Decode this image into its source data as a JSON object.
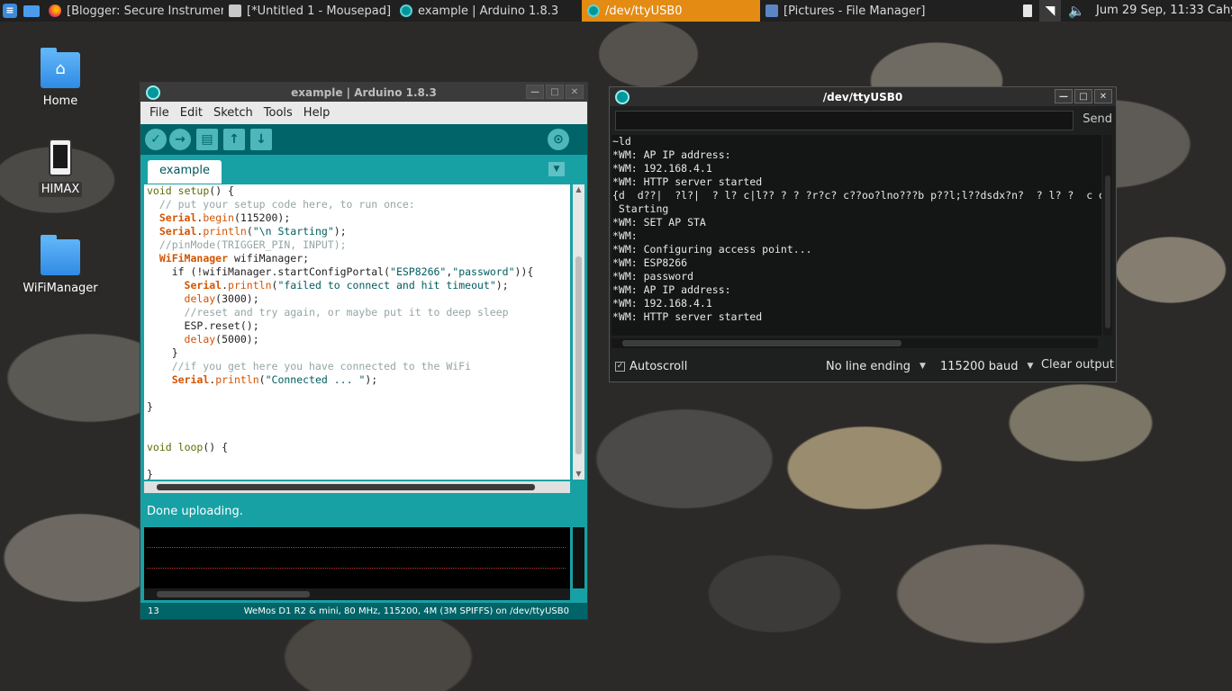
{
  "taskbar": {
    "tasks": [
      {
        "label": "[Blogger: Secure Instrumen..."
      },
      {
        "label": "[*Untitled 1 - Mousepad]"
      },
      {
        "label": "example | Arduino 1.8.3"
      },
      {
        "label": "/dev/ttyUSB0"
      },
      {
        "label": "[Pictures - File Manager]"
      }
    ],
    "clock": "Jum 29 Sep, 11:33",
    "user": "Cahyo"
  },
  "desktop": {
    "icons": [
      {
        "label": "Home",
        "icon": "home-folder-icon"
      },
      {
        "label": "HIMAX",
        "icon": "phone-icon"
      },
      {
        "label": "WiFiManager",
        "icon": "folder-icon"
      }
    ]
  },
  "arduino": {
    "title": "example | Arduino 1.8.3",
    "menu": [
      "File",
      "Edit",
      "Sketch",
      "Tools",
      "Help"
    ],
    "tab": "example",
    "code": [
      "void setup() {",
      "  // put your setup code here, to run once:",
      "  Serial.begin(115200);",
      "  Serial.println(\"\\n Starting\");",
      "  //pinMode(TRIGGER_PIN, INPUT);",
      "  WiFiManager wifiManager;",
      "    if (!wifiManager.startConfigPortal(\"ESP8266\",\"password\")){",
      "      Serial.println(\"failed to connect and hit timeout\");",
      "      delay(3000);",
      "      //reset and try again, or maybe put it to deep sleep",
      "      ESP.reset();",
      "      delay(5000);",
      "    }",
      "    //if you get here you have connected to the WiFi",
      "    Serial.println(\"Connected ... \");",
      "",
      "}",
      "",
      "",
      "void loop() {",
      "",
      "}"
    ],
    "status": "Done uploading.",
    "line_number": "13",
    "board_info": "WeMos D1 R2 & mini, 80 MHz, 115200, 4M (3M SPIFFS) on /dev/ttyUSB0"
  },
  "serial": {
    "title": "/dev/ttyUSB0",
    "input_value": "",
    "send_label": "Send",
    "output": [
      "~ld",
      "*WM: AP IP address:",
      "*WM: 192.168.4.1",
      "*WM: HTTP server started",
      "{d  d??|  ?l?|  ? l? c|l?? ? ? ?r?c? c??oo?lno???b p??l;l??dsdx?n?  ? l? ?  c o?|?l ?c??o",
      " Starting",
      "*WM: SET AP STA",
      "*WM:",
      "*WM: Configuring access point...",
      "*WM: ESP8266",
      "*WM: password",
      "*WM: AP IP address:",
      "*WM: 192.168.4.1",
      "*WM: HTTP server started"
    ],
    "autoscroll_label": "Autoscroll",
    "autoscroll_checked": true,
    "line_ending": "No line ending",
    "baud": "115200 baud",
    "clear_label": "Clear output"
  },
  "colors": {
    "arduino_teal": "#17a1a5",
    "arduino_dark": "#006468",
    "active_task": "#e38b12"
  }
}
